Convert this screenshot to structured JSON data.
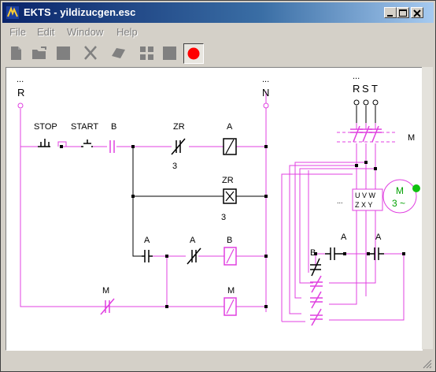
{
  "window": {
    "title": "EKTS - yildizucgen.esc"
  },
  "menu": [
    "File",
    "Edit",
    "Window",
    "Help"
  ],
  "toolbar": {
    "buttons": [
      "new-file",
      "open-folder",
      "save",
      "delete",
      "component",
      "simulate",
      "stop",
      "record"
    ],
    "record_color": "#ff0000"
  },
  "circuit": {
    "wire_color": "#e040e0",
    "line_color": "#000000",
    "motor_color": "#00a000",
    "ellipsis": "...",
    "supply_left": "R",
    "supply_right": "N",
    "three_phase": [
      "R",
      "S",
      "T"
    ],
    "stop_label": "STOP",
    "start_label": "START",
    "contact_b": "B",
    "zr_contact": "ZR",
    "zr_contact_value": "3",
    "coil_a": "A",
    "coil_zr": "ZR",
    "coil_zr_value": "3",
    "row3_contact_1": "A",
    "row3_contact_2": "A",
    "coil_b": "B",
    "contact_m": "M",
    "coil_m": "M",
    "main_contacts": "M",
    "motor_top": "U V W",
    "motor_bottom": "Z X Y",
    "motor_dots": "...",
    "motor_name": "M",
    "motor_type": "3 ~",
    "power_b": "B",
    "power_a1": "A",
    "power_a2": "A"
  }
}
